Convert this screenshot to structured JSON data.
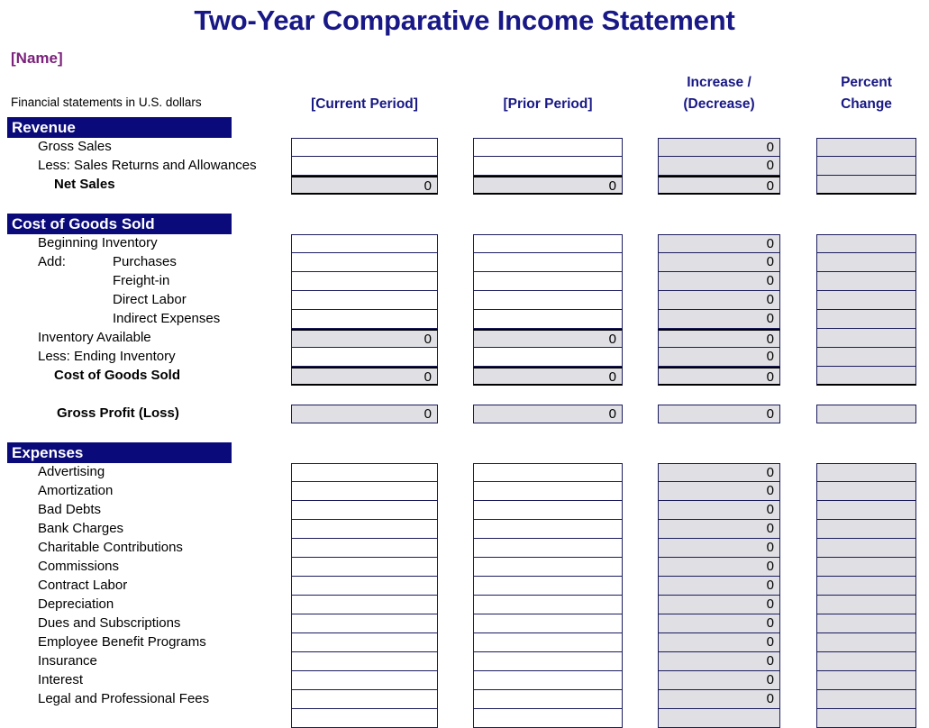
{
  "document": {
    "title": "Two-Year Comparative Income Statement",
    "company_placeholder": "[Name]",
    "currency_note": "Financial statements in U.S. dollars"
  },
  "colors": {
    "title": "#181886",
    "company": "#7B217B",
    "section_bar": "#0A0A7A",
    "shaded_cell": "#E0E0E4",
    "grid_line": "#1B1B5E"
  },
  "columns": [
    {
      "key": "current",
      "label": "[Current Period]"
    },
    {
      "key": "prior",
      "label": "[Prior Period]"
    },
    {
      "key": "increase",
      "label_line1": "Increase /",
      "label_line2": "(Decrease)"
    },
    {
      "key": "percent",
      "label_line1": "Percent",
      "label_line2": "Change"
    }
  ],
  "sections": [
    {
      "id": "revenue",
      "header": "Revenue",
      "rows": [
        {
          "label": "Gross Sales",
          "indent": "ind1",
          "style": "input",
          "current": "",
          "prior": "",
          "increase": "0",
          "percent": ""
        },
        {
          "label": "Less: Sales Returns and Allowances",
          "indent": "ind1",
          "style": "input",
          "current": "",
          "prior": "",
          "increase": "0",
          "percent": ""
        },
        {
          "label": "Net Sales",
          "indent": "indb",
          "style": "total",
          "current": "0",
          "prior": "0",
          "increase": "0",
          "percent": ""
        }
      ]
    },
    {
      "id": "cogs",
      "header": "Cost of Goods Sold",
      "rows": [
        {
          "label": "Beginning Inventory",
          "indent": "ind1",
          "style": "input",
          "current": "",
          "prior": "",
          "increase": "0",
          "percent": ""
        },
        {
          "label": "Add:",
          "indent": "ind1",
          "label2": "Purchases",
          "style": "input",
          "current": "",
          "prior": "",
          "increase": "0",
          "percent": ""
        },
        {
          "label": "",
          "indent": "ind1",
          "label2": "Freight-in",
          "style": "input",
          "current": "",
          "prior": "",
          "increase": "0",
          "percent": ""
        },
        {
          "label": "",
          "indent": "ind1",
          "label2": "Direct Labor",
          "style": "input",
          "current": "",
          "prior": "",
          "increase": "0",
          "percent": ""
        },
        {
          "label": "",
          "indent": "ind1",
          "label2": "Indirect Expenses",
          "style": "input",
          "current": "",
          "prior": "",
          "increase": "0",
          "percent": ""
        },
        {
          "label": "Inventory Available",
          "indent": "ind1",
          "style": "subtotal",
          "current": "0",
          "prior": "0",
          "increase": "0",
          "percent": ""
        },
        {
          "label": "Less: Ending Inventory",
          "indent": "ind1",
          "style": "input",
          "current": "",
          "prior": "",
          "increase": "0",
          "percent": ""
        },
        {
          "label": "Cost of Goods Sold",
          "indent": "indb",
          "style": "total",
          "current": "0",
          "prior": "0",
          "increase": "0",
          "percent": ""
        }
      ]
    },
    {
      "id": "gross-profit",
      "header": null,
      "rows": [
        {
          "label": "Gross Profit (Loss)",
          "indent": "indb2",
          "style": "calc",
          "current": "0",
          "prior": "0",
          "increase": "0",
          "percent": ""
        }
      ]
    },
    {
      "id": "expenses",
      "header": "Expenses",
      "rows": [
        {
          "label": "Advertising",
          "indent": "ind1",
          "style": "input",
          "current": "",
          "prior": "",
          "increase": "0",
          "percent": ""
        },
        {
          "label": "Amortization",
          "indent": "ind1",
          "style": "input",
          "current": "",
          "prior": "",
          "increase": "0",
          "percent": ""
        },
        {
          "label": "Bad Debts",
          "indent": "ind1",
          "style": "input",
          "current": "",
          "prior": "",
          "increase": "0",
          "percent": ""
        },
        {
          "label": "Bank Charges",
          "indent": "ind1",
          "style": "input",
          "current": "",
          "prior": "",
          "increase": "0",
          "percent": ""
        },
        {
          "label": "Charitable Contributions",
          "indent": "ind1",
          "style": "input",
          "current": "",
          "prior": "",
          "increase": "0",
          "percent": ""
        },
        {
          "label": "Commissions",
          "indent": "ind1",
          "style": "input",
          "current": "",
          "prior": "",
          "increase": "0",
          "percent": ""
        },
        {
          "label": "Contract Labor",
          "indent": "ind1",
          "style": "input",
          "current": "",
          "prior": "",
          "increase": "0",
          "percent": ""
        },
        {
          "label": "Depreciation",
          "indent": "ind1",
          "style": "input",
          "current": "",
          "prior": "",
          "increase": "0",
          "percent": ""
        },
        {
          "label": "Dues and Subscriptions",
          "indent": "ind1",
          "style": "input",
          "current": "",
          "prior": "",
          "increase": "0",
          "percent": ""
        },
        {
          "label": "Employee Benefit Programs",
          "indent": "ind1",
          "style": "input",
          "current": "",
          "prior": "",
          "increase": "0",
          "percent": ""
        },
        {
          "label": "Insurance",
          "indent": "ind1",
          "style": "input",
          "current": "",
          "prior": "",
          "increase": "0",
          "percent": ""
        },
        {
          "label": "Interest",
          "indent": "ind1",
          "style": "input",
          "current": "",
          "prior": "",
          "increase": "0",
          "percent": ""
        },
        {
          "label": "Legal and Professional Fees",
          "indent": "ind1",
          "style": "input",
          "current": "",
          "prior": "",
          "increase": "0",
          "percent": ""
        },
        {
          "label": "",
          "indent": "ind1",
          "style": "input",
          "current": "",
          "prior": "",
          "increase": "",
          "percent": ""
        }
      ]
    }
  ]
}
